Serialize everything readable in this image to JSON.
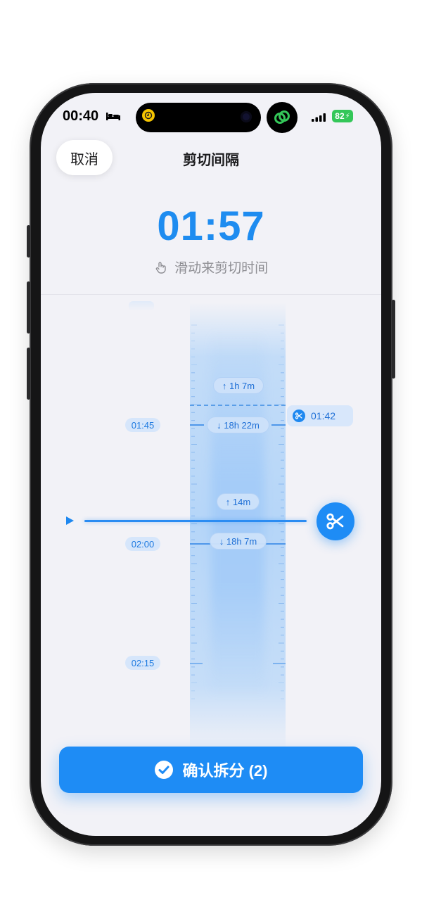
{
  "status": {
    "time": "00:40",
    "battery": "82"
  },
  "nav": {
    "cancel_label": "取消",
    "title": "剪切间隔"
  },
  "header": {
    "current_time": "01:57",
    "hint": "滑动来剪切时间"
  },
  "timeline": {
    "labels": [
      "01:45",
      "02:00",
      "02:15"
    ],
    "segments": [
      {
        "label": "↑ 1h 7m"
      },
      {
        "label": "↓ 18h 22m"
      },
      {
        "label": "↑ 14m"
      },
      {
        "label": "↓ 18h 7m"
      }
    ],
    "cut_marker": "01:42"
  },
  "footer": {
    "confirm_label": "确认拆分 (2)"
  },
  "colors": {
    "accent": "#1e8cf5",
    "background": "#f2f2f7"
  }
}
